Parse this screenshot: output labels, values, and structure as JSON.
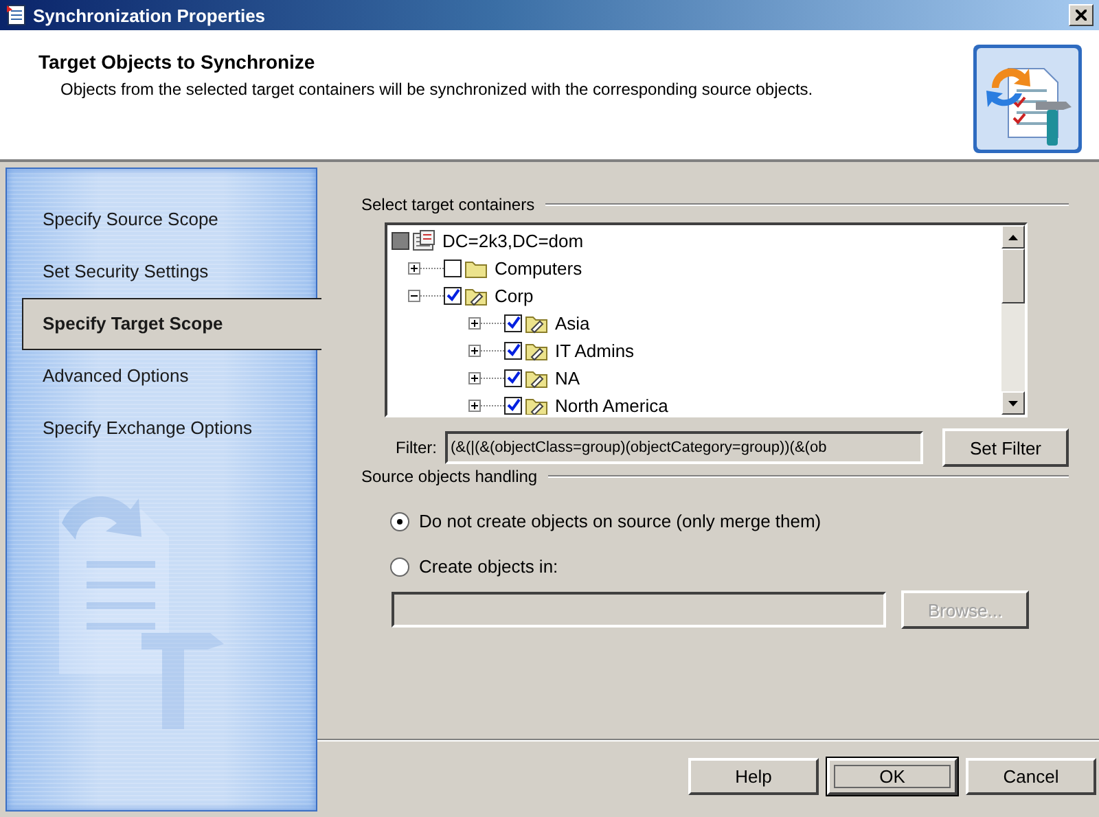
{
  "window": {
    "title": "Synchronization Properties"
  },
  "header": {
    "title": "Target Objects to Synchronize",
    "description": "Objects from the selected target containers will be synchronized with the corresponding source objects."
  },
  "sidebar": {
    "items": [
      {
        "label": "Specify Source Scope",
        "selected": false
      },
      {
        "label": "Set Security Settings",
        "selected": false
      },
      {
        "label": "Specify Target Scope",
        "selected": true
      },
      {
        "label": "Advanced Options",
        "selected": false
      },
      {
        "label": "Specify Exchange Options",
        "selected": false
      }
    ]
  },
  "target_containers": {
    "label": "Select target containers",
    "tree": [
      {
        "label": "DC=2k3,DC=dom",
        "kind": "domain",
        "checked": false,
        "mixed": true,
        "children": [
          {
            "label": "Computers",
            "kind": "folder",
            "checked": false,
            "expanded": false
          },
          {
            "label": "Corp",
            "kind": "ou",
            "checked": true,
            "expanded": true,
            "children": [
              {
                "label": "Asia",
                "kind": "ou",
                "checked": true,
                "expanded": false
              },
              {
                "label": "IT Admins",
                "kind": "ou",
                "checked": true,
                "expanded": false
              },
              {
                "label": "NA",
                "kind": "ou",
                "checked": true,
                "expanded": false
              },
              {
                "label": "North America",
                "kind": "ou",
                "checked": true,
                "expanded": false
              }
            ]
          }
        ]
      }
    ],
    "filter": {
      "label": "Filter:",
      "value": "(&(|(&(objectClass=group)(objectCategory=group))(&(ob",
      "button": "Set Filter"
    }
  },
  "source_handling": {
    "label": "Source objects handling",
    "options": [
      {
        "label": "Do not create objects on source (only merge them)",
        "selected": true
      },
      {
        "label": "Create objects in:",
        "selected": false
      }
    ],
    "location": {
      "disabled": true
    },
    "browse": {
      "label": "Browse...",
      "disabled": true
    }
  },
  "buttons": [
    {
      "label": "Help",
      "default": false
    },
    {
      "label": "OK",
      "default": true
    },
    {
      "label": "Cancel",
      "default": false
    }
  ]
}
